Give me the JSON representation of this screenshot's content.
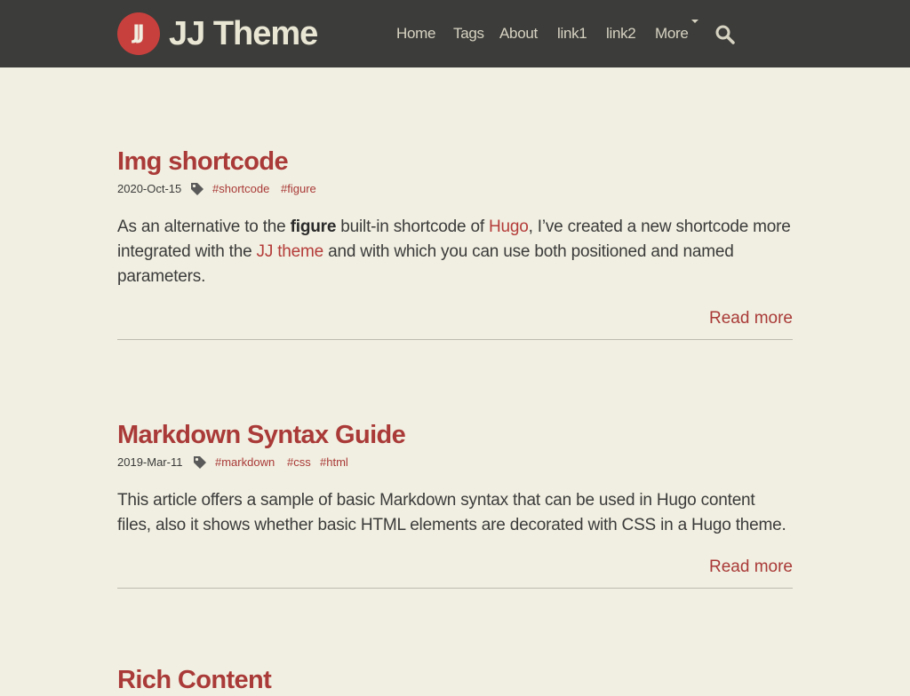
{
  "header": {
    "logo_text": "JJ",
    "site_title": "JJ Theme",
    "nav": [
      "Home",
      "Tags",
      "About",
      "link1",
      "link2",
      "More"
    ],
    "search_icon": "search-icon"
  },
  "posts": [
    {
      "title": "Img shortcode",
      "date": "2020-Oct-15",
      "tags": [
        "#shortcode",
        "#figure"
      ],
      "excerpt": {
        "t1": "As an alternative to the ",
        "bold": "figure",
        "t2": " built-in shortcode of ",
        "link1": "Hugo",
        "t3": ", I’ve created a new shortcode more integrated with the ",
        "link2": "JJ theme",
        "t4": " and with which you can use both positioned and named parameters."
      },
      "read_more": "Read more"
    },
    {
      "title": "Markdown Syntax Guide",
      "date": "2019-Mar-11",
      "tags": [
        "#markdown",
        "#css",
        "#html"
      ],
      "excerpt": "This article offers a sample of basic Markdown syntax that can be used in Hugo content files, also it shows whether basic HTML elements are decorated with CSS in a Hugo theme.",
      "read_more": "Read more"
    },
    {
      "title": "Rich Content"
    }
  ],
  "colors": {
    "background": "#f1efe1",
    "header": "#3c3c3a",
    "accent": "#a93a38",
    "logo": "#c8403d"
  }
}
